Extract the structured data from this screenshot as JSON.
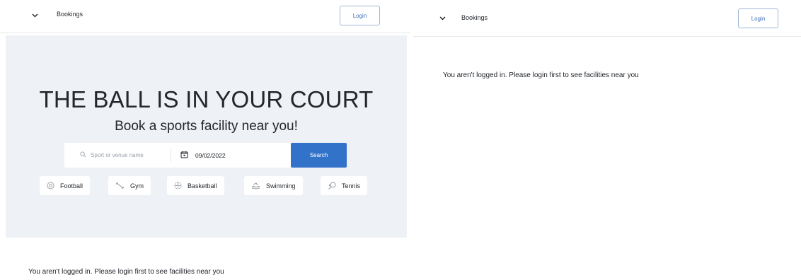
{
  "left": {
    "nav": {
      "title": "Bookings",
      "login_label": "Login",
      "menu_icon": "chevron-down-icon"
    },
    "hero": {
      "title": "THE BALL IS IN YOUR COURT",
      "subtitle": "Book a sports facility near you!",
      "search": {
        "placeholder": "Sport or venue name",
        "date": "09/02/2022",
        "button_label": "Search"
      },
      "sports": [
        {
          "label": "Football",
          "icon": "football-icon"
        },
        {
          "label": "Gym",
          "icon": "dumbbell-icon"
        },
        {
          "label": "Basketball",
          "icon": "basketball-icon"
        },
        {
          "label": "Swimming",
          "icon": "swimming-icon"
        },
        {
          "label": "Tennis",
          "icon": "tennis-icon"
        }
      ]
    },
    "message": "You aren't logged in. Please login first to see facilities near you"
  },
  "right": {
    "nav": {
      "title": "Bookings",
      "login_label": "Login",
      "menu_icon": "chevron-down-icon"
    },
    "message": "You aren't logged in. Please login first to see facilities near you"
  },
  "colors": {
    "accent": "#3273c9",
    "hero_background": "#eef1f6",
    "login_border": "#9fb6d6"
  }
}
